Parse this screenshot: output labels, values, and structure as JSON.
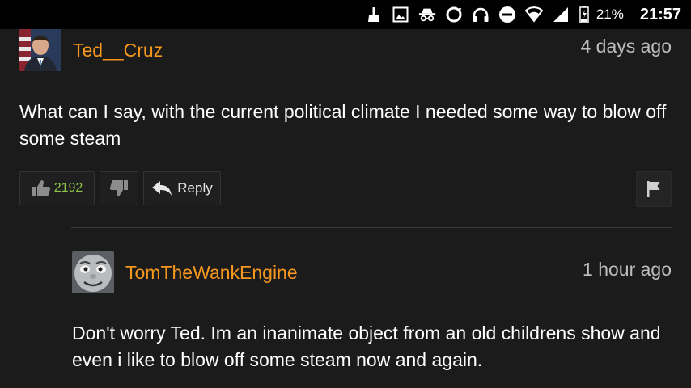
{
  "status_bar": {
    "icons": [
      "broom-icon",
      "image-icon",
      "incognito-icon",
      "circle-sync-icon",
      "headphones-icon",
      "do-not-disturb-icon",
      "wifi-icon",
      "signal-icon",
      "battery-charging-icon"
    ],
    "battery_percent": "21%",
    "time": "21:57"
  },
  "comments": [
    {
      "username": "Ted__Cruz",
      "timestamp": "4 days ago",
      "text": "What can I say, with the current political climate I needed some way to blow off some steam",
      "likes": "2192",
      "reply_label": "Reply",
      "avatar": "ted-cruz-portrait"
    },
    {
      "username": "TomTheWankEngine",
      "timestamp": "1 hour ago",
      "text": "Don't worry Ted. Im an inanimate object from an old childrens show and even i like to blow off some steam now and again.",
      "avatar": "thomas-train-face"
    }
  ],
  "colors": {
    "username": "#f7971d",
    "likes": "#8bc34a",
    "background": "#1b1b1b",
    "statusbar": "#000000"
  }
}
